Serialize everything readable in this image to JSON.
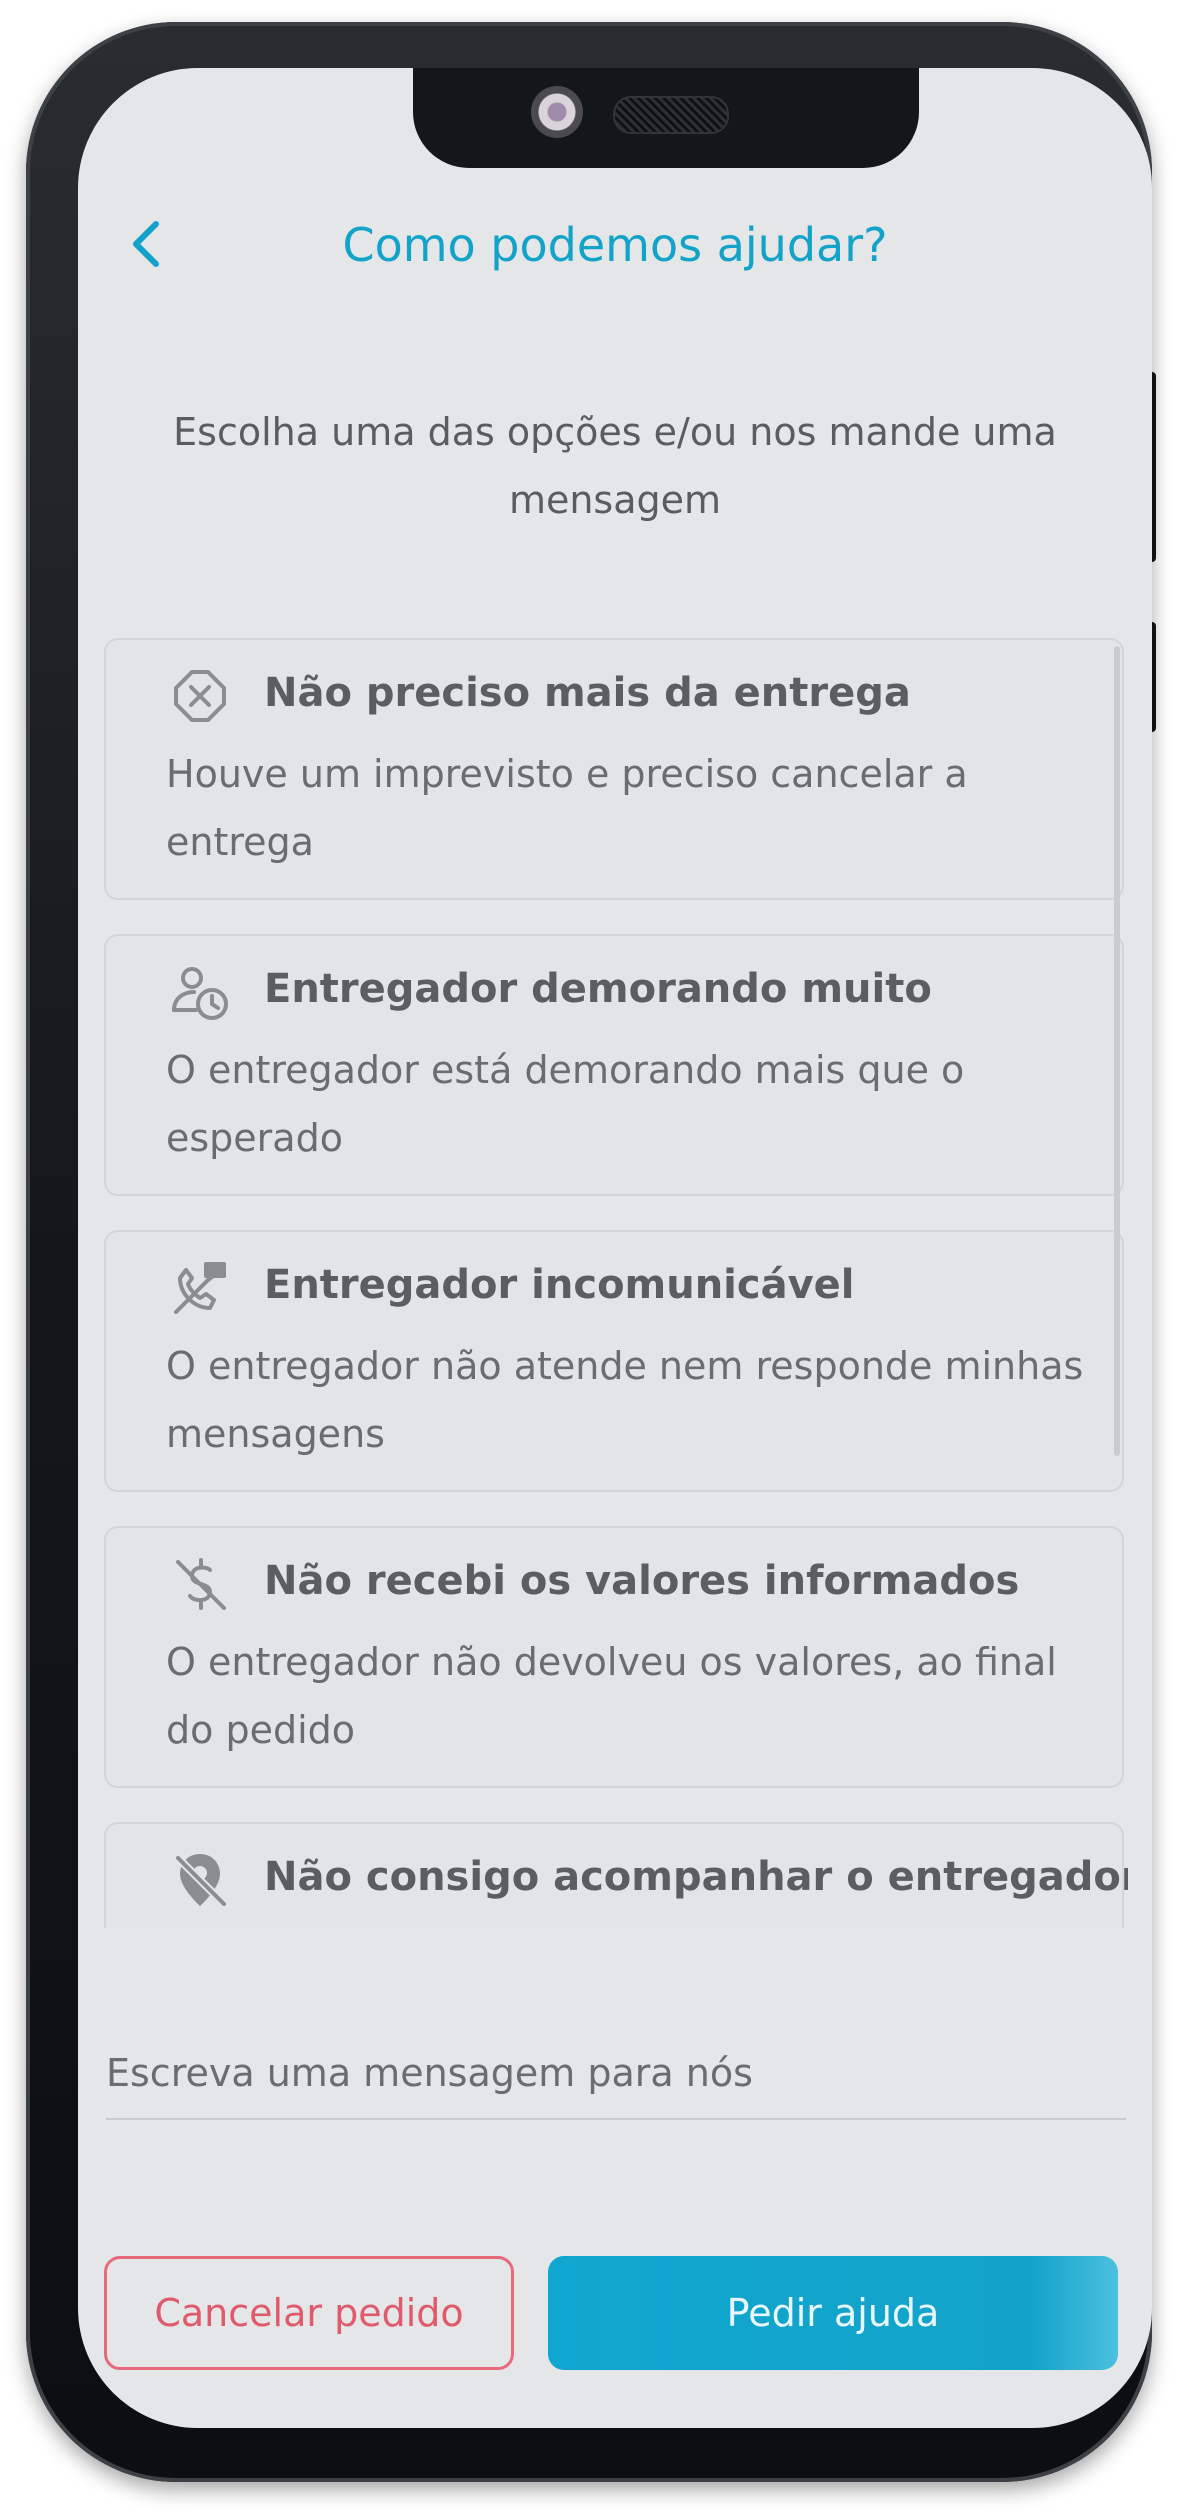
{
  "header": {
    "title": "Como podemos ajudar?"
  },
  "intro": "Escolha uma das opções e/ou nos mande uma mensagem",
  "options": [
    {
      "icon": "cancel-circle-icon",
      "title": "Não preciso mais da entrega",
      "description": "Houve um imprevisto e preciso cancelar a entrega"
    },
    {
      "icon": "person-clock-icon",
      "title": "Entregador demorando muito",
      "description": "O entregador está demorando mais que o esperado"
    },
    {
      "icon": "no-contact-icon",
      "title": "Entregador incomunicável",
      "description": "O entregador não atende nem responde minhas mensagens"
    },
    {
      "icon": "no-money-icon",
      "title": "Não recebi os valores informados",
      "description": "O entregador não devolveu os valores, ao final do pedido"
    },
    {
      "icon": "location-off-icon",
      "title": "Não consigo acompanhar o entregador",
      "description": ""
    }
  ],
  "message": {
    "placeholder": "Escreva uma mensagem para nós"
  },
  "actions": {
    "cancel_label": "Cancelar pedido",
    "help_label": "Pedir ajuda"
  },
  "colors": {
    "accent": "#13a3c9",
    "danger": "#e05a6c",
    "background": "#e4e6e7",
    "text": "#5b5e61"
  }
}
